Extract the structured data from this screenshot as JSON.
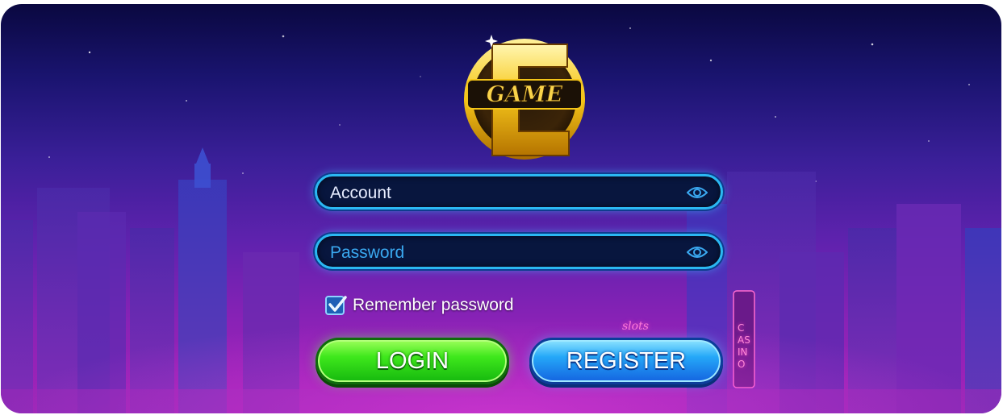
{
  "logo": {
    "line1": "GAME",
    "letter": "E"
  },
  "account_field": {
    "placeholder": "Account",
    "icon": "eye-icon"
  },
  "password_field": {
    "placeholder": "Password",
    "icon": "eye-icon"
  },
  "remember": {
    "label": "Remember password",
    "checked": true
  },
  "buttons": {
    "login": "LOGIN",
    "register": "REGISTER"
  },
  "signs": {
    "slots": "slots",
    "casino": "CASINO"
  },
  "colors": {
    "field_border": "#2bb8f2",
    "login_green": "#3fe81c",
    "register_blue": "#25a8f8",
    "logo_gold": "#f5c518"
  }
}
